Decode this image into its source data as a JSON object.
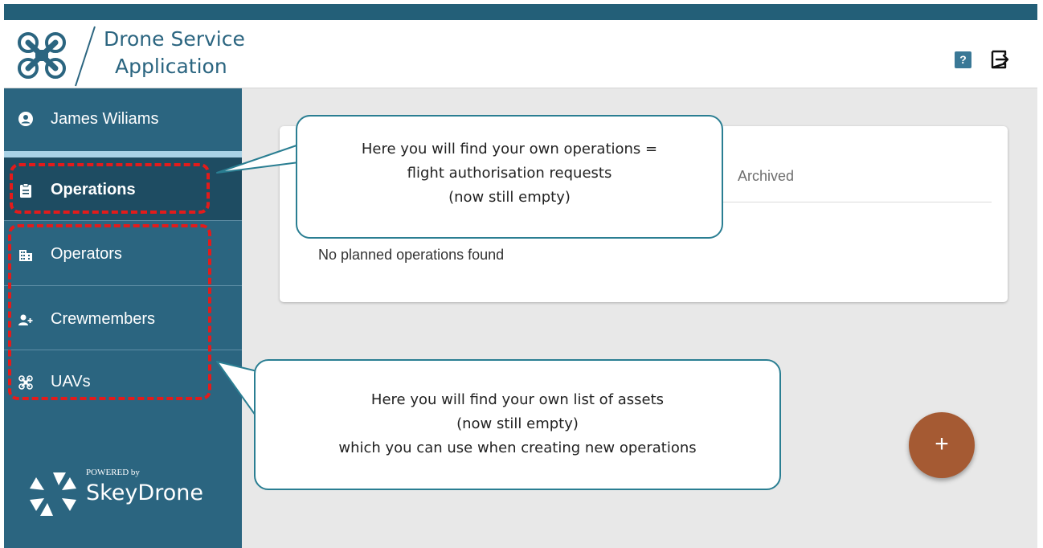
{
  "app": {
    "title_line1": "Drone Service",
    "title_line2": "Application",
    "help_label": "?"
  },
  "sidebar": {
    "user_name": "James Wiliams",
    "items": [
      {
        "label": "Operations",
        "icon": "clipboard-icon",
        "active": true
      },
      {
        "label": "Operators",
        "icon": "building-icon",
        "active": false
      },
      {
        "label": "Crewmembers",
        "icon": "add-person-icon",
        "active": false
      },
      {
        "label": "UAVs",
        "icon": "drone-icon",
        "active": false
      }
    ],
    "powered_by": "POWERED by",
    "brand": "SkeyDrone"
  },
  "main": {
    "tab_archived": "Archived",
    "empty_message": "No planned operations found",
    "fab_label": "+"
  },
  "callouts": {
    "operations": {
      "line1": "Here you will find your own operations =",
      "line2": "flight authorisation requests",
      "line3": "(now still empty)"
    },
    "assets": {
      "line1": "Here you will find your own list of assets",
      "line2": "(now still empty)",
      "line3": "which you can use when creating new operations"
    }
  },
  "colors": {
    "header_band": "#235f78",
    "sidebar": "#2b6580",
    "sidebar_active": "#1e4c62",
    "accent_light": "#a9d2e6",
    "fab": "#a55a33",
    "annotation_dash": "#e31b1b",
    "callout_border": "#2a7e92"
  }
}
